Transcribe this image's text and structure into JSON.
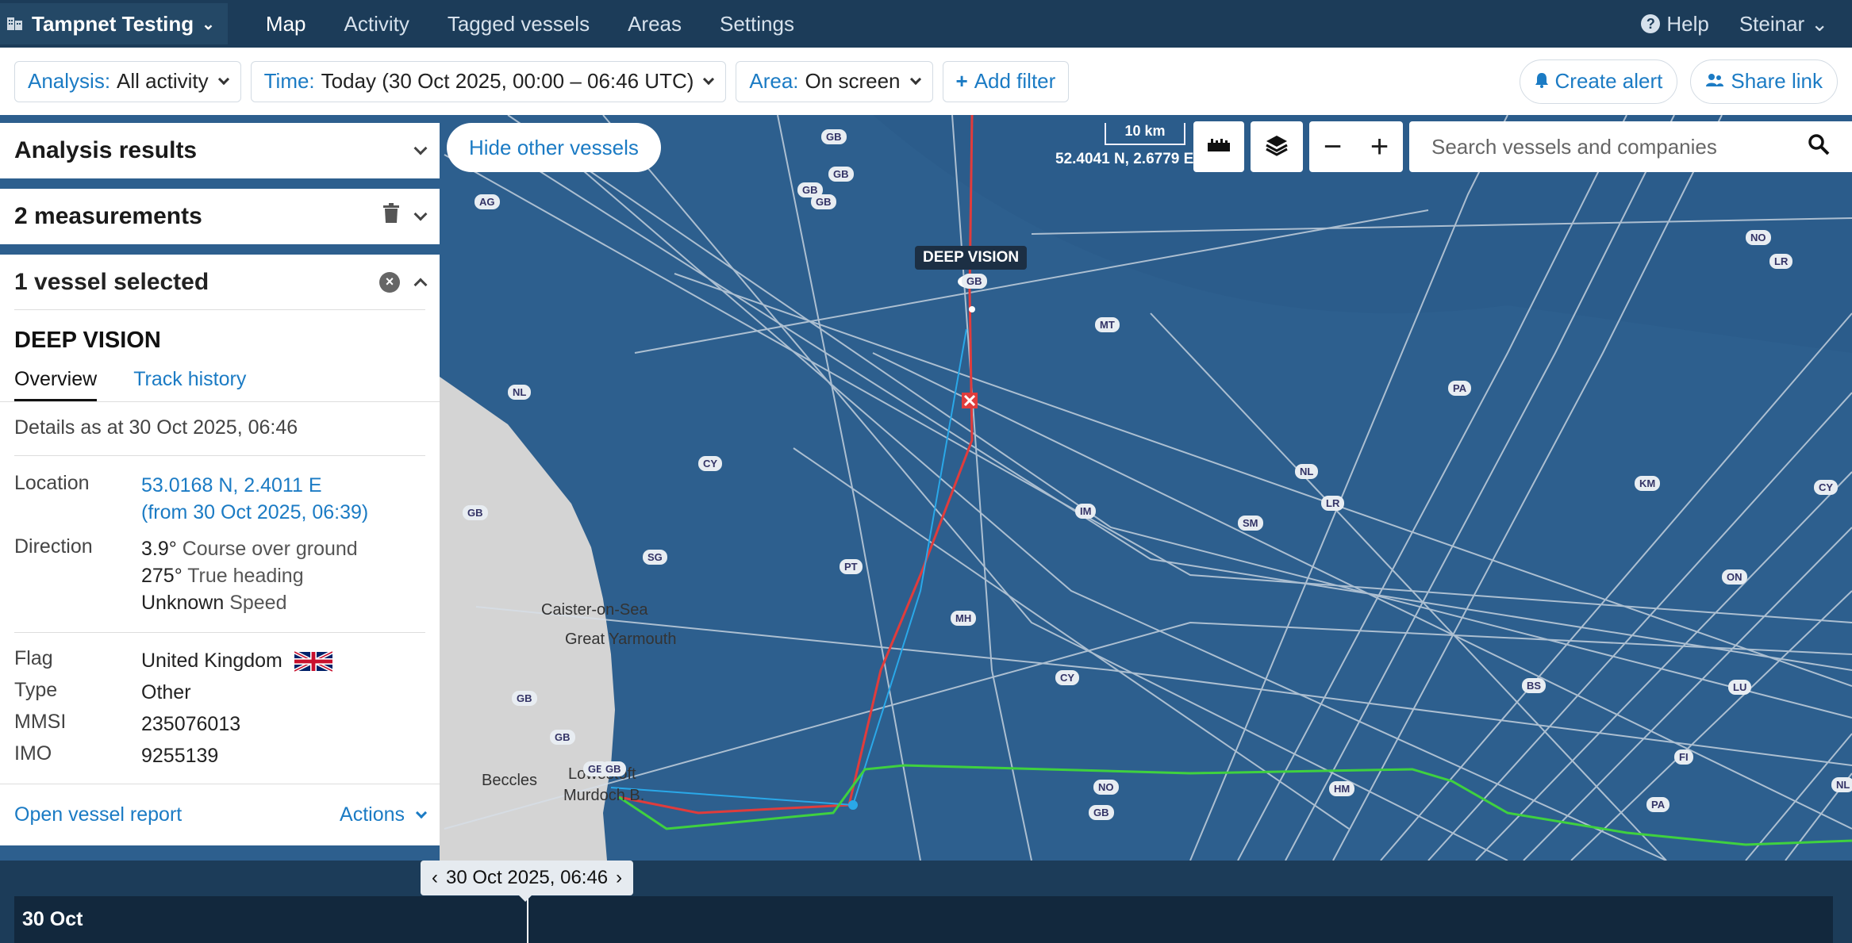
{
  "nav": {
    "brand": "Tampnet Testing",
    "items": [
      "Map",
      "Activity",
      "Tagged vessels",
      "Areas",
      "Settings"
    ],
    "help": "Help",
    "user": "Steinar"
  },
  "filters": {
    "analysis_key": "Analysis:",
    "analysis_val": "All activity",
    "time_key": "Time:",
    "time_val": "Today (30 Oct 2025, 00:00 – 06:46 UTC)",
    "area_key": "Area:",
    "area_val": "On screen",
    "add_filter": "Add filter",
    "create_alert": "Create alert",
    "share_link": "Share link"
  },
  "map": {
    "hide_other": "Hide other vessels",
    "scale": "10 km",
    "coords": "52.4041 N, 2.6779 E",
    "search_placeholder": "Search vessels and companies",
    "vessel_label": "DEEP VISION",
    "places": [
      "Caister-on-Sea",
      "Great Yarmouth",
      "Beccles",
      "Lowestoft",
      "Murdoch B."
    ],
    "tags": [
      "GB",
      "GB",
      "GB",
      "GB",
      "GB",
      "GB",
      "GB",
      "GB",
      "GB",
      "GB",
      "GB",
      "NL",
      "NL",
      "AG",
      "PT",
      "CY",
      "CY",
      "MH",
      "NO",
      "NO",
      "LR",
      "LR",
      "PA",
      "PA",
      "SM",
      "SG",
      "ON",
      "KM",
      "BS",
      "LU",
      "NL",
      "MT",
      "IM",
      "HM",
      "CY",
      "FI"
    ]
  },
  "panel": {
    "analysis_results": "Analysis results",
    "measurements": "2 measurements",
    "selected": "1 vessel selected",
    "vessel_name": "DEEP VISION",
    "tab_overview": "Overview",
    "tab_track": "Track history",
    "details_as": "Details as at 30 Oct 2025, 06:46",
    "location_lbl": "Location",
    "location_val": "53.0168 N, 2.4011 E",
    "location_from": "(from 30 Oct 2025, 06:39)",
    "direction_lbl": "Direction",
    "cog_val": "3.9°",
    "cog_lbl": "Course over ground",
    "heading_val": "275°",
    "heading_lbl": "True heading",
    "speed_val": "Unknown",
    "speed_lbl": "Speed",
    "flag_lbl": "Flag",
    "flag_val": "United Kingdom",
    "type_lbl": "Type",
    "type_val": "Other",
    "mmsi_lbl": "MMSI",
    "mmsi_val": "235076013",
    "imo_lbl": "IMO",
    "imo_val": "9255139",
    "open_report": "Open vessel report",
    "actions": "Actions"
  },
  "timeline": {
    "current": "30 Oct 2025, 06:46",
    "day": "30 Oct"
  },
  "colors": {
    "nav_bg": "#1c3c59",
    "accent": "#1b7bc4",
    "sea": "#2d5f8e",
    "land": "#d4d4d4",
    "track_red": "#e03c3c",
    "track_blue": "#2aa8e8",
    "track_green": "#3fd13f"
  }
}
